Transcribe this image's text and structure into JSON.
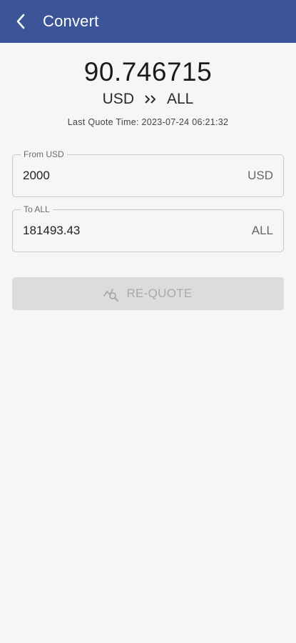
{
  "appbar": {
    "title": "Convert",
    "back_icon": "back-arrow-icon"
  },
  "rate": {
    "value": "90.746715",
    "from_currency": "USD",
    "to_currency": "ALL",
    "separator_icon": "double-chevron-right-icon"
  },
  "quote": {
    "last_quote_time": "Last Quote Time: 2023-07-24 06:21:32"
  },
  "from_field": {
    "label": "From USD",
    "value": "2000",
    "unit": "USD"
  },
  "to_field": {
    "label": "To ALL",
    "value": "181493.43",
    "unit": "ALL"
  },
  "requote_button": {
    "label": "RE-QUOTE",
    "icon": "trend-search-icon",
    "disabled": true
  },
  "colors": {
    "appbar": "#3b5598",
    "background": "#f6f6f6",
    "button_disabled_bg": "#dcdcdc",
    "button_disabled_text": "#a9a9a9"
  }
}
